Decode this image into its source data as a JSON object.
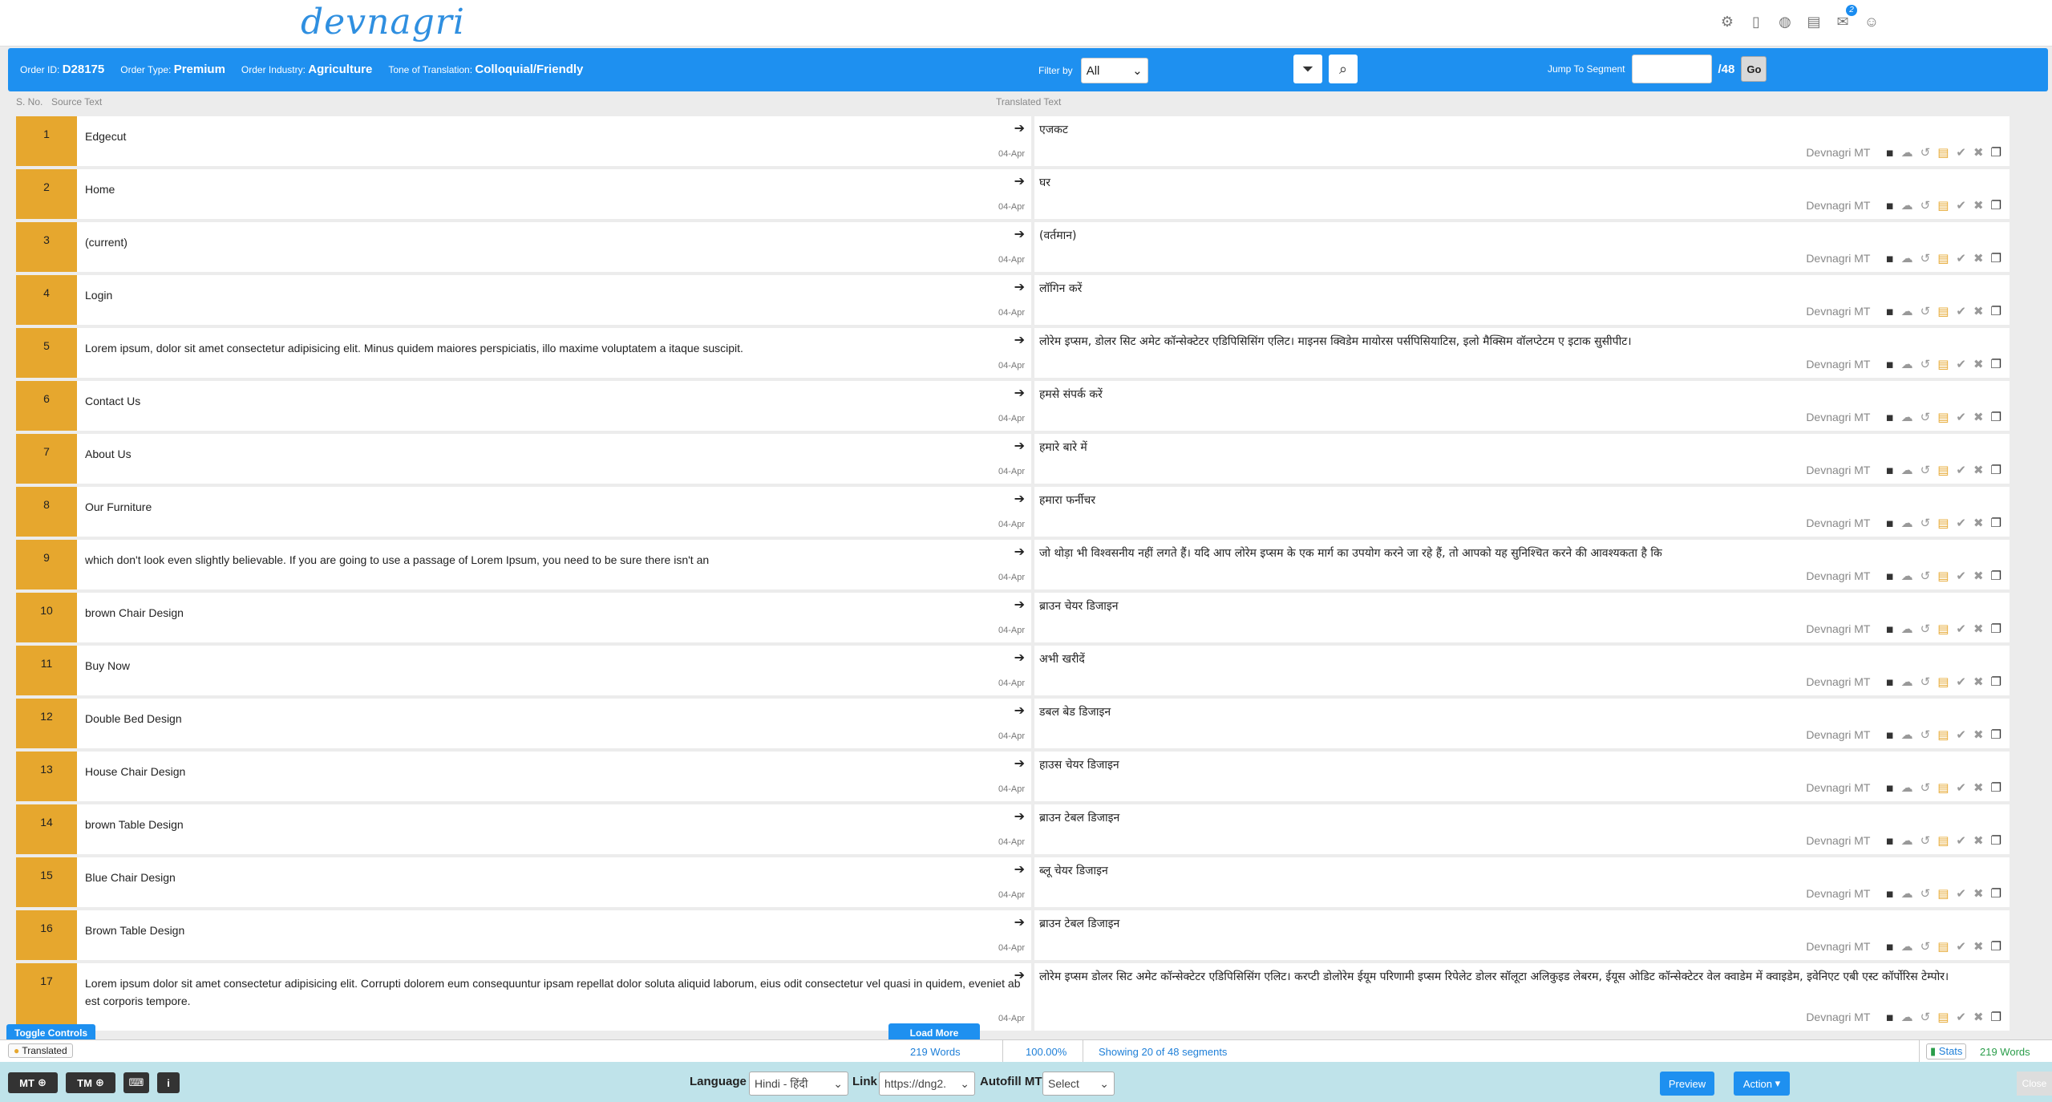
{
  "header": {
    "logo": "devnagri",
    "icons": [
      "translate-network-icon",
      "mobile-icon",
      "globe-icon",
      "document-icon",
      "mail-icon",
      "user-icon"
    ],
    "mail_badge": "2"
  },
  "order": {
    "id_label": "Order ID:",
    "id": "D28175",
    "type_label": "Order Type:",
    "type": "Premium",
    "industry_label": "Order Industry:",
    "industry": "Agriculture",
    "tone_label": "Tone of Translation:",
    "tone": "Colloquial/Friendly"
  },
  "filter": {
    "label": "Filter by",
    "value": "All"
  },
  "jump": {
    "label": "Jump To Segment",
    "total": "/48",
    "go": "Go"
  },
  "columns": {
    "sno": "S. No.",
    "source": "Source Text",
    "translated": "Translated Text"
  },
  "segment_mt_label": "Devnagri MT",
  "segments": [
    {
      "n": "1",
      "src": "Edgecut",
      "tgt": "एजकट",
      "date": "04-Apr"
    },
    {
      "n": "2",
      "src": "Home",
      "tgt": "घर",
      "date": "04-Apr"
    },
    {
      "n": "3",
      "src": "(current)",
      "tgt": "(वर्तमान)",
      "date": "04-Apr"
    },
    {
      "n": "4",
      "src": "Login",
      "tgt": "लॉगिन करें",
      "date": "04-Apr"
    },
    {
      "n": "5",
      "src": "Lorem ipsum, dolor sit amet consectetur adipisicing elit. Minus quidem maiores perspiciatis, illo maxime voluptatem a itaque suscipit.",
      "tgt": "लोरेम इप्सम, डोलर सिट अमेट कॉन्सेक्टेटर एडिपिसिसिंग एलिट। माइनस क्विडेम मायोरस पर्सपिसियाटिस, इलो मैक्सिम वॉलप्टेटम ए इटाक सुसीपीट।",
      "date": "04-Apr"
    },
    {
      "n": "6",
      "src": "Contact Us",
      "tgt": "हमसे संपर्क करें",
      "date": "04-Apr"
    },
    {
      "n": "7",
      "src": "About Us",
      "tgt": "हमारे बारे में",
      "date": "04-Apr"
    },
    {
      "n": "8",
      "src": "Our Furniture",
      "tgt": "हमारा फर्नीचर",
      "date": "04-Apr"
    },
    {
      "n": "9",
      "src": "which don't look even slightly believable. If you are going to use a passage of Lorem Ipsum, you need to be sure there isn't an",
      "tgt": "जो थोड़ा भी विश्वसनीय नहीं लगते हैं। यदि आप लोरेम इप्सम के एक मार्ग का उपयोग करने जा रहे हैं, तो आपको यह सुनिश्चित करने की आवश्यकता है कि",
      "date": "04-Apr"
    },
    {
      "n": "10",
      "src": "brown Chair Design",
      "tgt": "ब्राउन चेयर डिजाइन",
      "date": "04-Apr"
    },
    {
      "n": "11",
      "src": "Buy Now",
      "tgt": "अभी खरीदें",
      "date": "04-Apr"
    },
    {
      "n": "12",
      "src": "Double Bed Design",
      "tgt": "डबल बेड डिजाइन",
      "date": "04-Apr"
    },
    {
      "n": "13",
      "src": "House Chair Design",
      "tgt": "हाउस चेयर डिजाइन",
      "date": "04-Apr"
    },
    {
      "n": "14",
      "src": "brown Table Design",
      "tgt": "ब्राउन टेबल डिजाइन",
      "date": "04-Apr"
    },
    {
      "n": "15",
      "src": "Blue Chair Design",
      "tgt": "ब्लू चेयर डिजाइन",
      "date": "04-Apr"
    },
    {
      "n": "16",
      "src": "Brown Table Design",
      "tgt": "ब्राउन टेबल डिजाइन",
      "date": "04-Apr"
    },
    {
      "n": "17",
      "src": "Lorem ipsum dolor sit amet consectetur adipisicing elit. Corrupti dolorem eum consequuntur ipsam repellat dolor soluta aliquid laborum, eius odit consectetur vel quasi in quidem, eveniet ab est corporis tempore.",
      "tgt": "लोरेम इप्सम डोलर सिट अमेट कॉन्सेक्टेटर एडिपिसिसिंग एलिट। करप्टी डोलोरेम ईयूम परिणामी इप्सम रिपेलेट डोलर सॉलूटा अलिकुइड लेबरम, ईयूस ओडिट कॉन्सेक्टेटर वेल क्वाडेम में क्वाइडेम, इवेनिएट एबी एस्ट कॉर्पोरिस टेम्पोर।",
      "date": "04-Apr"
    }
  ],
  "controls": {
    "toggle": "Toggle Controls",
    "load_more": "Load More"
  },
  "status": {
    "translated_label": "Translated",
    "words": "219 Words",
    "percent": "100.00%",
    "showing": "Showing 20 of 48 segments",
    "stats_label": "Stats",
    "stats_words": "219 Words"
  },
  "bottom": {
    "mt": "MT",
    "tm": "TM",
    "language_label": "Language",
    "language_value": "Hindi - हिंदी",
    "link_label": "Link",
    "link_value": "https://dng2.",
    "autofill_label": "Autofill MT",
    "autofill_value": "Select",
    "preview": "Preview",
    "action": "Action",
    "close": "Close"
  },
  "colors": {
    "accent": "#1e90f0",
    "segment_num_bg": "#e6a72e",
    "bottom_bar": "#bfe3ea"
  }
}
